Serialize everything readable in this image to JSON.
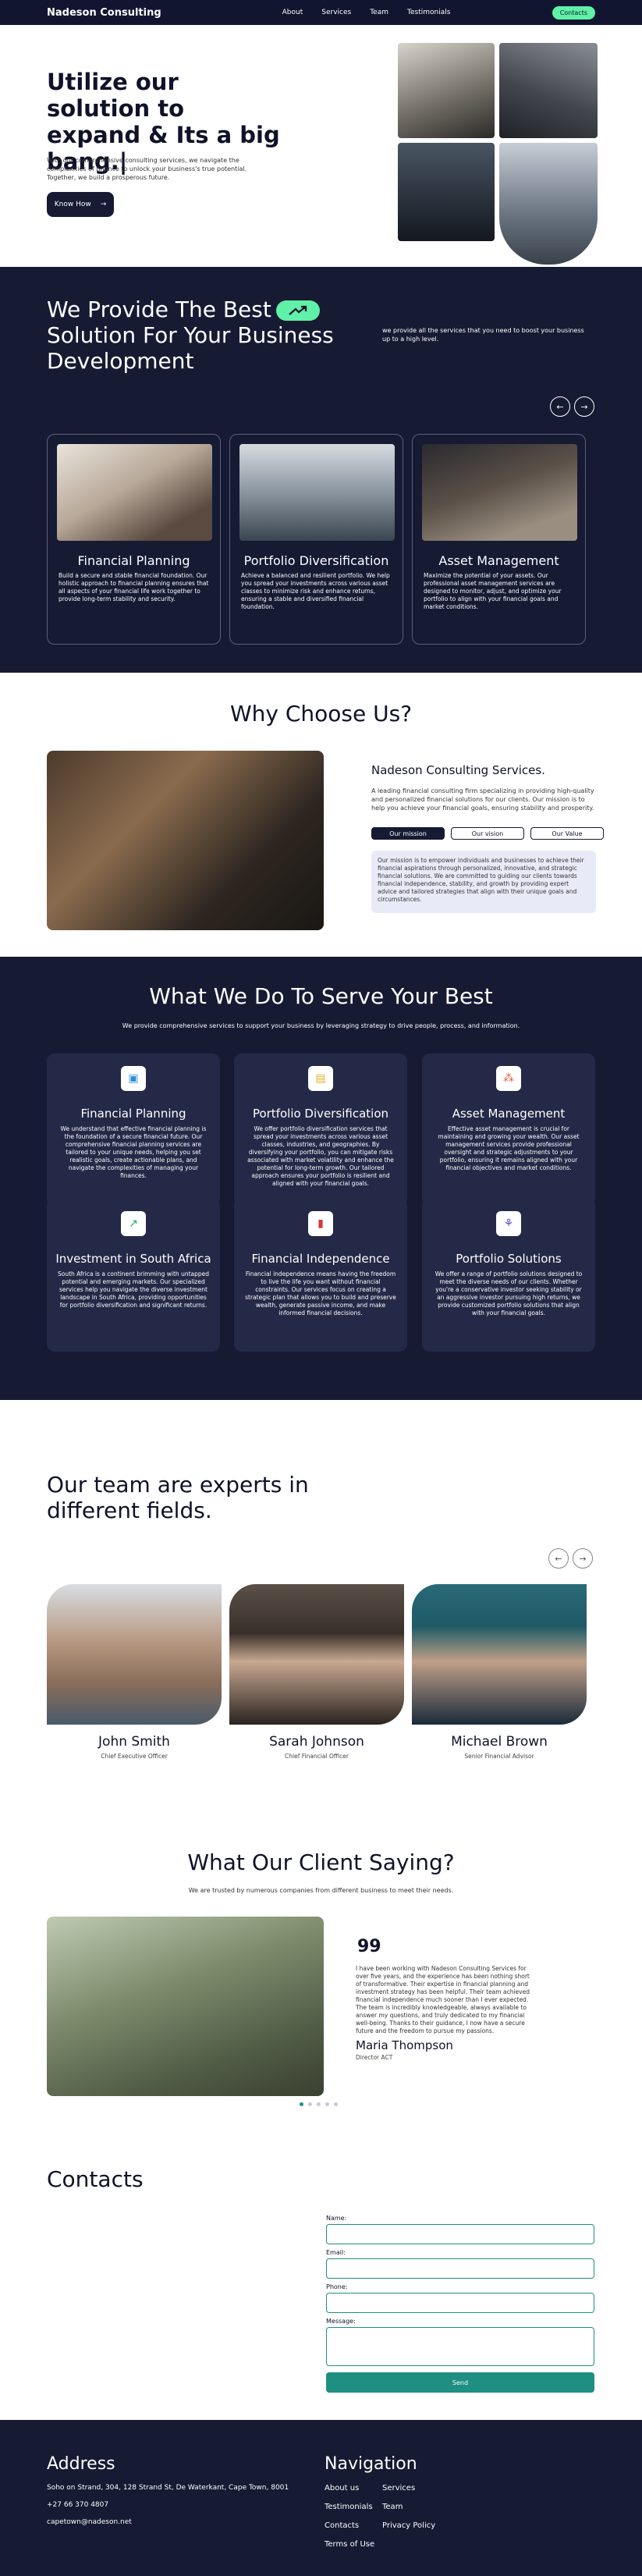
{
  "nav": {
    "brand": "Nadeson Consulting",
    "links": [
      "About",
      "Services",
      "Team",
      "Testimonials"
    ],
    "contact": "Contacts"
  },
  "hero": {
    "title": "Utilize our solution to expand & Its a big bang.|",
    "intro": "With our comprehensive consulting services, we navigate the complexities of finance to unlock your business's true potential. Together, we build a prosperous future.",
    "button": "Know How",
    "arrow": "→"
  },
  "services": {
    "title": "We Provide The Best",
    "title2": "Solution For Your Business Development",
    "side": "we provide all the services that you need to boost your business up to a high level.",
    "prev": "←",
    "next": "→",
    "cards": [
      {
        "title": "Financial Planning",
        "desc": "Build a secure and stable financial foundation. Our holistic approach to financial planning ensures that all aspects of your financial life work together to provide long-term stability and security."
      },
      {
        "title": "Portfolio Diversification",
        "desc": "Achieve a balanced and resilient portfolio. We help you spread your investments across various asset classes to minimize risk and enhance returns, ensuring a stable and diversified financial foundation."
      },
      {
        "title": "Asset Management",
        "desc": "Maximize the potential of your assets. Our professional asset management services are designed to monitor, adjust, and optimize your portfolio to align with your financial goals and market conditions."
      }
    ]
  },
  "why": {
    "title": "Why Choose Us?",
    "heading": "Nadeson Consulting Services.",
    "para": "A leading financial consulting firm specializing in providing high-quality and personalized financial solutions for our clients. Our mission is to help you achieve your financial goals, ensuring stability and prosperity.",
    "tabs": [
      "Our mission",
      "Our vision",
      "Our Value"
    ],
    "box": "Our mission is to empower individuals and businesses to achieve their financial aspirations through personalized, innovative, and strategic financial solutions. We are committed to guiding our clients towards financial independence, stability, and growth by providing expert advice and tailored strategies that align with their unique goals and circumstances."
  },
  "wwd": {
    "title": "What We Do To Serve Your Best",
    "sub": "We provide comprehensive services to support your business by leveraging strategy to drive people, process, and information.",
    "cards": [
      {
        "title": "Financial Planning",
        "icon": "calendar-icon",
        "glyph": "▣",
        "color": "#2e8fd6",
        "desc": "We understand that effective financial planning is the foundation of a secure financial future. Our comprehensive financial planning services are tailored to your unique needs, helping you set realistic goals, create actionable plans, and navigate the complexities of managing your finances."
      },
      {
        "title": "Portfolio Diversification",
        "icon": "briefcase-icon",
        "glyph": "▤",
        "color": "#e0b020",
        "desc": "We offer portfolio diversification services that spread your investments across various asset classes, industries, and geographies. By diversifying your portfolio, you can mitigate risks associated with market volatility and enhance the potential for long-term growth. Our tailored approach ensures your portfolio is resilient and aligned with your financial goals."
      },
      {
        "title": "Asset Management",
        "icon": "nodes-icon",
        "glyph": "⁂",
        "color": "#e05a3a",
        "desc": "Effective asset management is crucial for maintaining and growing your wealth. Our asset management services provide professional oversight and strategic adjustments to your portfolio, ensuring it remains aligned with your financial objectives and market conditions."
      },
      {
        "title": "Investment in South Africa",
        "icon": "chart-up-icon",
        "glyph": "↗",
        "color": "#28a860",
        "desc": "South Africa is a continent brimming with untapped potential and emerging markets. Our specialized services help you navigate the diverse investment landscape in South Africa, providing opportunities for portfolio diversification and significant returns."
      },
      {
        "title": "Financial Independence",
        "icon": "document-icon",
        "glyph": "▮",
        "color": "#d23a3a",
        "desc": "Financial independence means having the freedom to live the life you want without financial constraints. Our services focus on creating a strategic plan that allows you to build and preserve wealth, generate passive income, and make informed financial decisions."
      },
      {
        "title": "Portfolio Solutions",
        "icon": "network-icon",
        "glyph": "⚘",
        "color": "#5a4fd0",
        "desc": "We offer a range of portfolio solutions designed to meet the diverse needs of our clients. Whether you're a conservative investor seeking stability or an aggressive investor pursuing high returns, we provide customized portfolio solutions that align with your financial goals."
      }
    ]
  },
  "team": {
    "title": "Our team are experts in different fields.",
    "prev": "←",
    "next": "→",
    "members": [
      {
        "name": "John Smith",
        "role": "Chief Executive Officer"
      },
      {
        "name": "Sarah Johnson",
        "role": "Chief Financial Officer"
      },
      {
        "name": "Michael Brown",
        "role": "Senior Financial Advisor"
      }
    ]
  },
  "testimonial": {
    "title": "What Our Client Saying?",
    "sub": "We are trusted by numerous companies from different business to meet their needs.",
    "quote_mark": "99",
    "text": "I have been working with Nadeson Consulting Services for over five years, and the experience has been nothing short of transformative. Their expertise in financial planning and investment strategy has been helpful. Their team achieved financial independence much sooner than I ever expected. The team is incredibly knowledgeable, always available to answer my questions, and truly dedicated to my financial well-being. Thanks to their guidance, I now have a secure future and the freedom to pursue my passions.",
    "name": "Maria Thompson",
    "role": "Director ACT"
  },
  "contacts": {
    "title": "Contacts",
    "name_label": "Name:",
    "email_label": "Email:",
    "phone_label": "Phone:",
    "message_label": "Message:",
    "send": "Send"
  },
  "footer": {
    "address_title": "Address",
    "address": "Soho on Strand, 304, 128 Strand St, De Waterkant, Cape Town, 8001",
    "phone": "+27 66 370 4807",
    "email": "capetown@nadeson.net",
    "nav_title": "Navigation",
    "nav_links": [
      "About us",
      "Services",
      "Testimonials",
      "Team",
      "Contacts",
      "Privacy Policy",
      "Terms of Use"
    ]
  }
}
